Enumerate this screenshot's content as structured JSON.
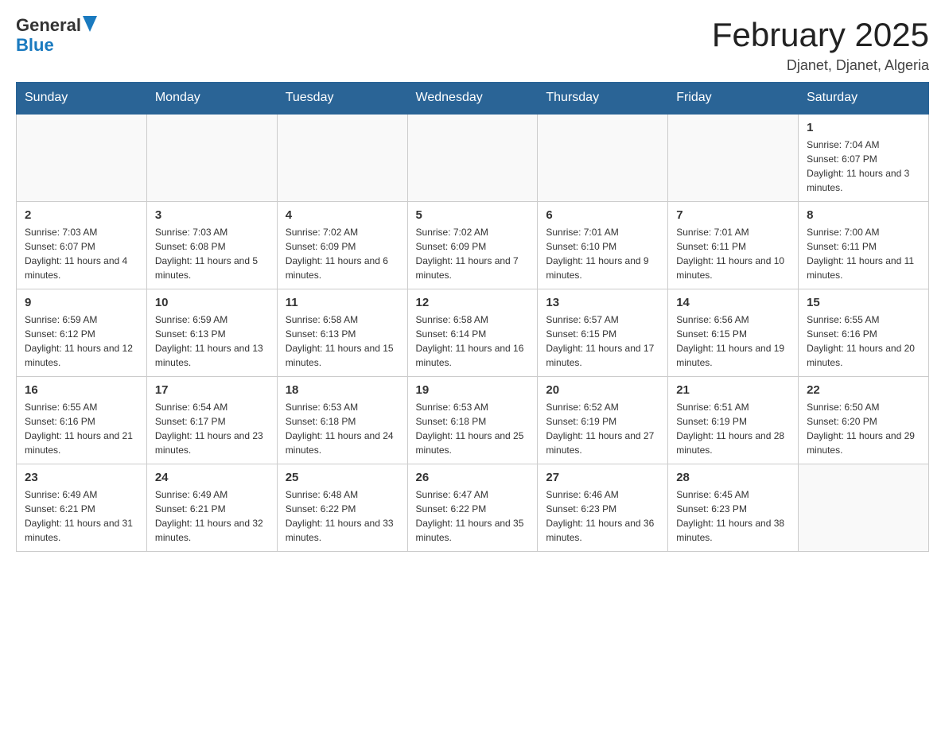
{
  "header": {
    "logo": {
      "general": "General",
      "blue": "Blue"
    },
    "title": "February 2025",
    "location": "Djanet, Djanet, Algeria"
  },
  "weekdays": [
    "Sunday",
    "Monday",
    "Tuesday",
    "Wednesday",
    "Thursday",
    "Friday",
    "Saturday"
  ],
  "weeks": [
    [
      {
        "day": null,
        "info": null
      },
      {
        "day": null,
        "info": null
      },
      {
        "day": null,
        "info": null
      },
      {
        "day": null,
        "info": null
      },
      {
        "day": null,
        "info": null
      },
      {
        "day": null,
        "info": null
      },
      {
        "day": "1",
        "info": "Sunrise: 7:04 AM\nSunset: 6:07 PM\nDaylight: 11 hours and 3 minutes."
      }
    ],
    [
      {
        "day": "2",
        "info": "Sunrise: 7:03 AM\nSunset: 6:07 PM\nDaylight: 11 hours and 4 minutes."
      },
      {
        "day": "3",
        "info": "Sunrise: 7:03 AM\nSunset: 6:08 PM\nDaylight: 11 hours and 5 minutes."
      },
      {
        "day": "4",
        "info": "Sunrise: 7:02 AM\nSunset: 6:09 PM\nDaylight: 11 hours and 6 minutes."
      },
      {
        "day": "5",
        "info": "Sunrise: 7:02 AM\nSunset: 6:09 PM\nDaylight: 11 hours and 7 minutes."
      },
      {
        "day": "6",
        "info": "Sunrise: 7:01 AM\nSunset: 6:10 PM\nDaylight: 11 hours and 9 minutes."
      },
      {
        "day": "7",
        "info": "Sunrise: 7:01 AM\nSunset: 6:11 PM\nDaylight: 11 hours and 10 minutes."
      },
      {
        "day": "8",
        "info": "Sunrise: 7:00 AM\nSunset: 6:11 PM\nDaylight: 11 hours and 11 minutes."
      }
    ],
    [
      {
        "day": "9",
        "info": "Sunrise: 6:59 AM\nSunset: 6:12 PM\nDaylight: 11 hours and 12 minutes."
      },
      {
        "day": "10",
        "info": "Sunrise: 6:59 AM\nSunset: 6:13 PM\nDaylight: 11 hours and 13 minutes."
      },
      {
        "day": "11",
        "info": "Sunrise: 6:58 AM\nSunset: 6:13 PM\nDaylight: 11 hours and 15 minutes."
      },
      {
        "day": "12",
        "info": "Sunrise: 6:58 AM\nSunset: 6:14 PM\nDaylight: 11 hours and 16 minutes."
      },
      {
        "day": "13",
        "info": "Sunrise: 6:57 AM\nSunset: 6:15 PM\nDaylight: 11 hours and 17 minutes."
      },
      {
        "day": "14",
        "info": "Sunrise: 6:56 AM\nSunset: 6:15 PM\nDaylight: 11 hours and 19 minutes."
      },
      {
        "day": "15",
        "info": "Sunrise: 6:55 AM\nSunset: 6:16 PM\nDaylight: 11 hours and 20 minutes."
      }
    ],
    [
      {
        "day": "16",
        "info": "Sunrise: 6:55 AM\nSunset: 6:16 PM\nDaylight: 11 hours and 21 minutes."
      },
      {
        "day": "17",
        "info": "Sunrise: 6:54 AM\nSunset: 6:17 PM\nDaylight: 11 hours and 23 minutes."
      },
      {
        "day": "18",
        "info": "Sunrise: 6:53 AM\nSunset: 6:18 PM\nDaylight: 11 hours and 24 minutes."
      },
      {
        "day": "19",
        "info": "Sunrise: 6:53 AM\nSunset: 6:18 PM\nDaylight: 11 hours and 25 minutes."
      },
      {
        "day": "20",
        "info": "Sunrise: 6:52 AM\nSunset: 6:19 PM\nDaylight: 11 hours and 27 minutes."
      },
      {
        "day": "21",
        "info": "Sunrise: 6:51 AM\nSunset: 6:19 PM\nDaylight: 11 hours and 28 minutes."
      },
      {
        "day": "22",
        "info": "Sunrise: 6:50 AM\nSunset: 6:20 PM\nDaylight: 11 hours and 29 minutes."
      }
    ],
    [
      {
        "day": "23",
        "info": "Sunrise: 6:49 AM\nSunset: 6:21 PM\nDaylight: 11 hours and 31 minutes."
      },
      {
        "day": "24",
        "info": "Sunrise: 6:49 AM\nSunset: 6:21 PM\nDaylight: 11 hours and 32 minutes."
      },
      {
        "day": "25",
        "info": "Sunrise: 6:48 AM\nSunset: 6:22 PM\nDaylight: 11 hours and 33 minutes."
      },
      {
        "day": "26",
        "info": "Sunrise: 6:47 AM\nSunset: 6:22 PM\nDaylight: 11 hours and 35 minutes."
      },
      {
        "day": "27",
        "info": "Sunrise: 6:46 AM\nSunset: 6:23 PM\nDaylight: 11 hours and 36 minutes."
      },
      {
        "day": "28",
        "info": "Sunrise: 6:45 AM\nSunset: 6:23 PM\nDaylight: 11 hours and 38 minutes."
      },
      {
        "day": null,
        "info": null
      }
    ]
  ]
}
